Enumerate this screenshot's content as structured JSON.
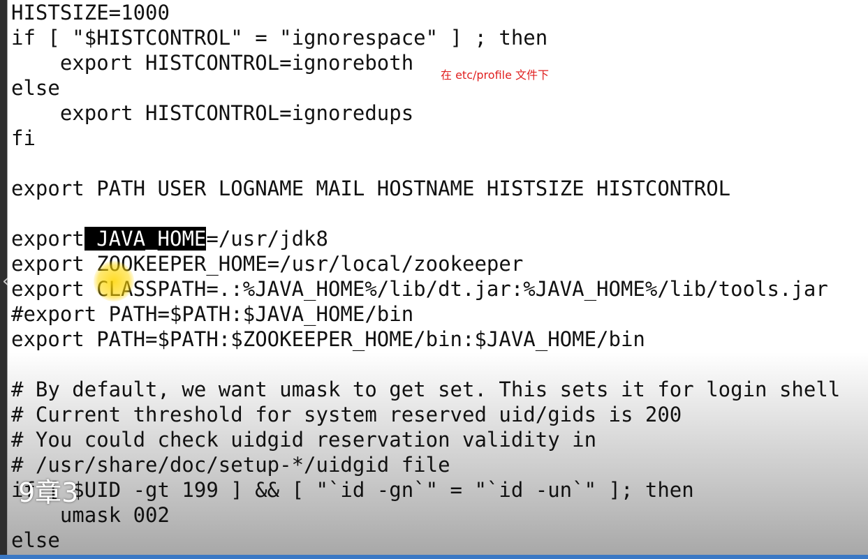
{
  "editor": {
    "lines": [
      "HISTSIZE=1000",
      "if [ \"$HISTCONTROL\" = \"ignorespace\" ] ; then",
      "    export HISTCONTROL=ignoreboth",
      "else",
      "    export HISTCONTROL=ignoredups",
      "fi",
      "",
      "export PATH USER LOGNAME MAIL HOSTNAME HISTSIZE HISTCONTROL",
      "",
      "",
      "export ZOOKEEPER_HOME=/usr/local/zookeeper",
      "export CLASSPATH=.:%JAVA_HOME%/lib/dt.jar:%JAVA_HOME%/lib/tools.jar",
      "#export PATH=$PATH:$JAVA_HOME/bin",
      "export PATH=$PATH:$ZOOKEEPER_HOME/bin:$JAVA_HOME/bin",
      "",
      "# By default, we want umask to get set. This sets it for login shell",
      "# Current threshold for system reserved uid/gids is 200",
      "# You could check uidgid reservation validity in",
      "# /usr/share/doc/setup-*/uidgid file",
      "if [ $UID -gt 199 ] && [ \"`id -gn`\" = \"`id -un`\" ]; then",
      "    umask 002",
      "else"
    ],
    "java_line": {
      "prefix": "export",
      "selection": " JAVA_HOME",
      "suffix": "=/usr/jdk8"
    }
  },
  "annotation": {
    "text": "在 etc/profile 文件下",
    "color": "#e02020"
  },
  "overlay": {
    "chapter_label": "9章3"
  },
  "icons": {
    "scroll_left": "chevron-left-icon",
    "cursor_highlight": "cursor-highlight-icon"
  },
  "colors": {
    "selection_bg": "#000000",
    "selection_fg": "#ffffff",
    "text": "#111111",
    "bottom_bar": "#3a78c4"
  }
}
